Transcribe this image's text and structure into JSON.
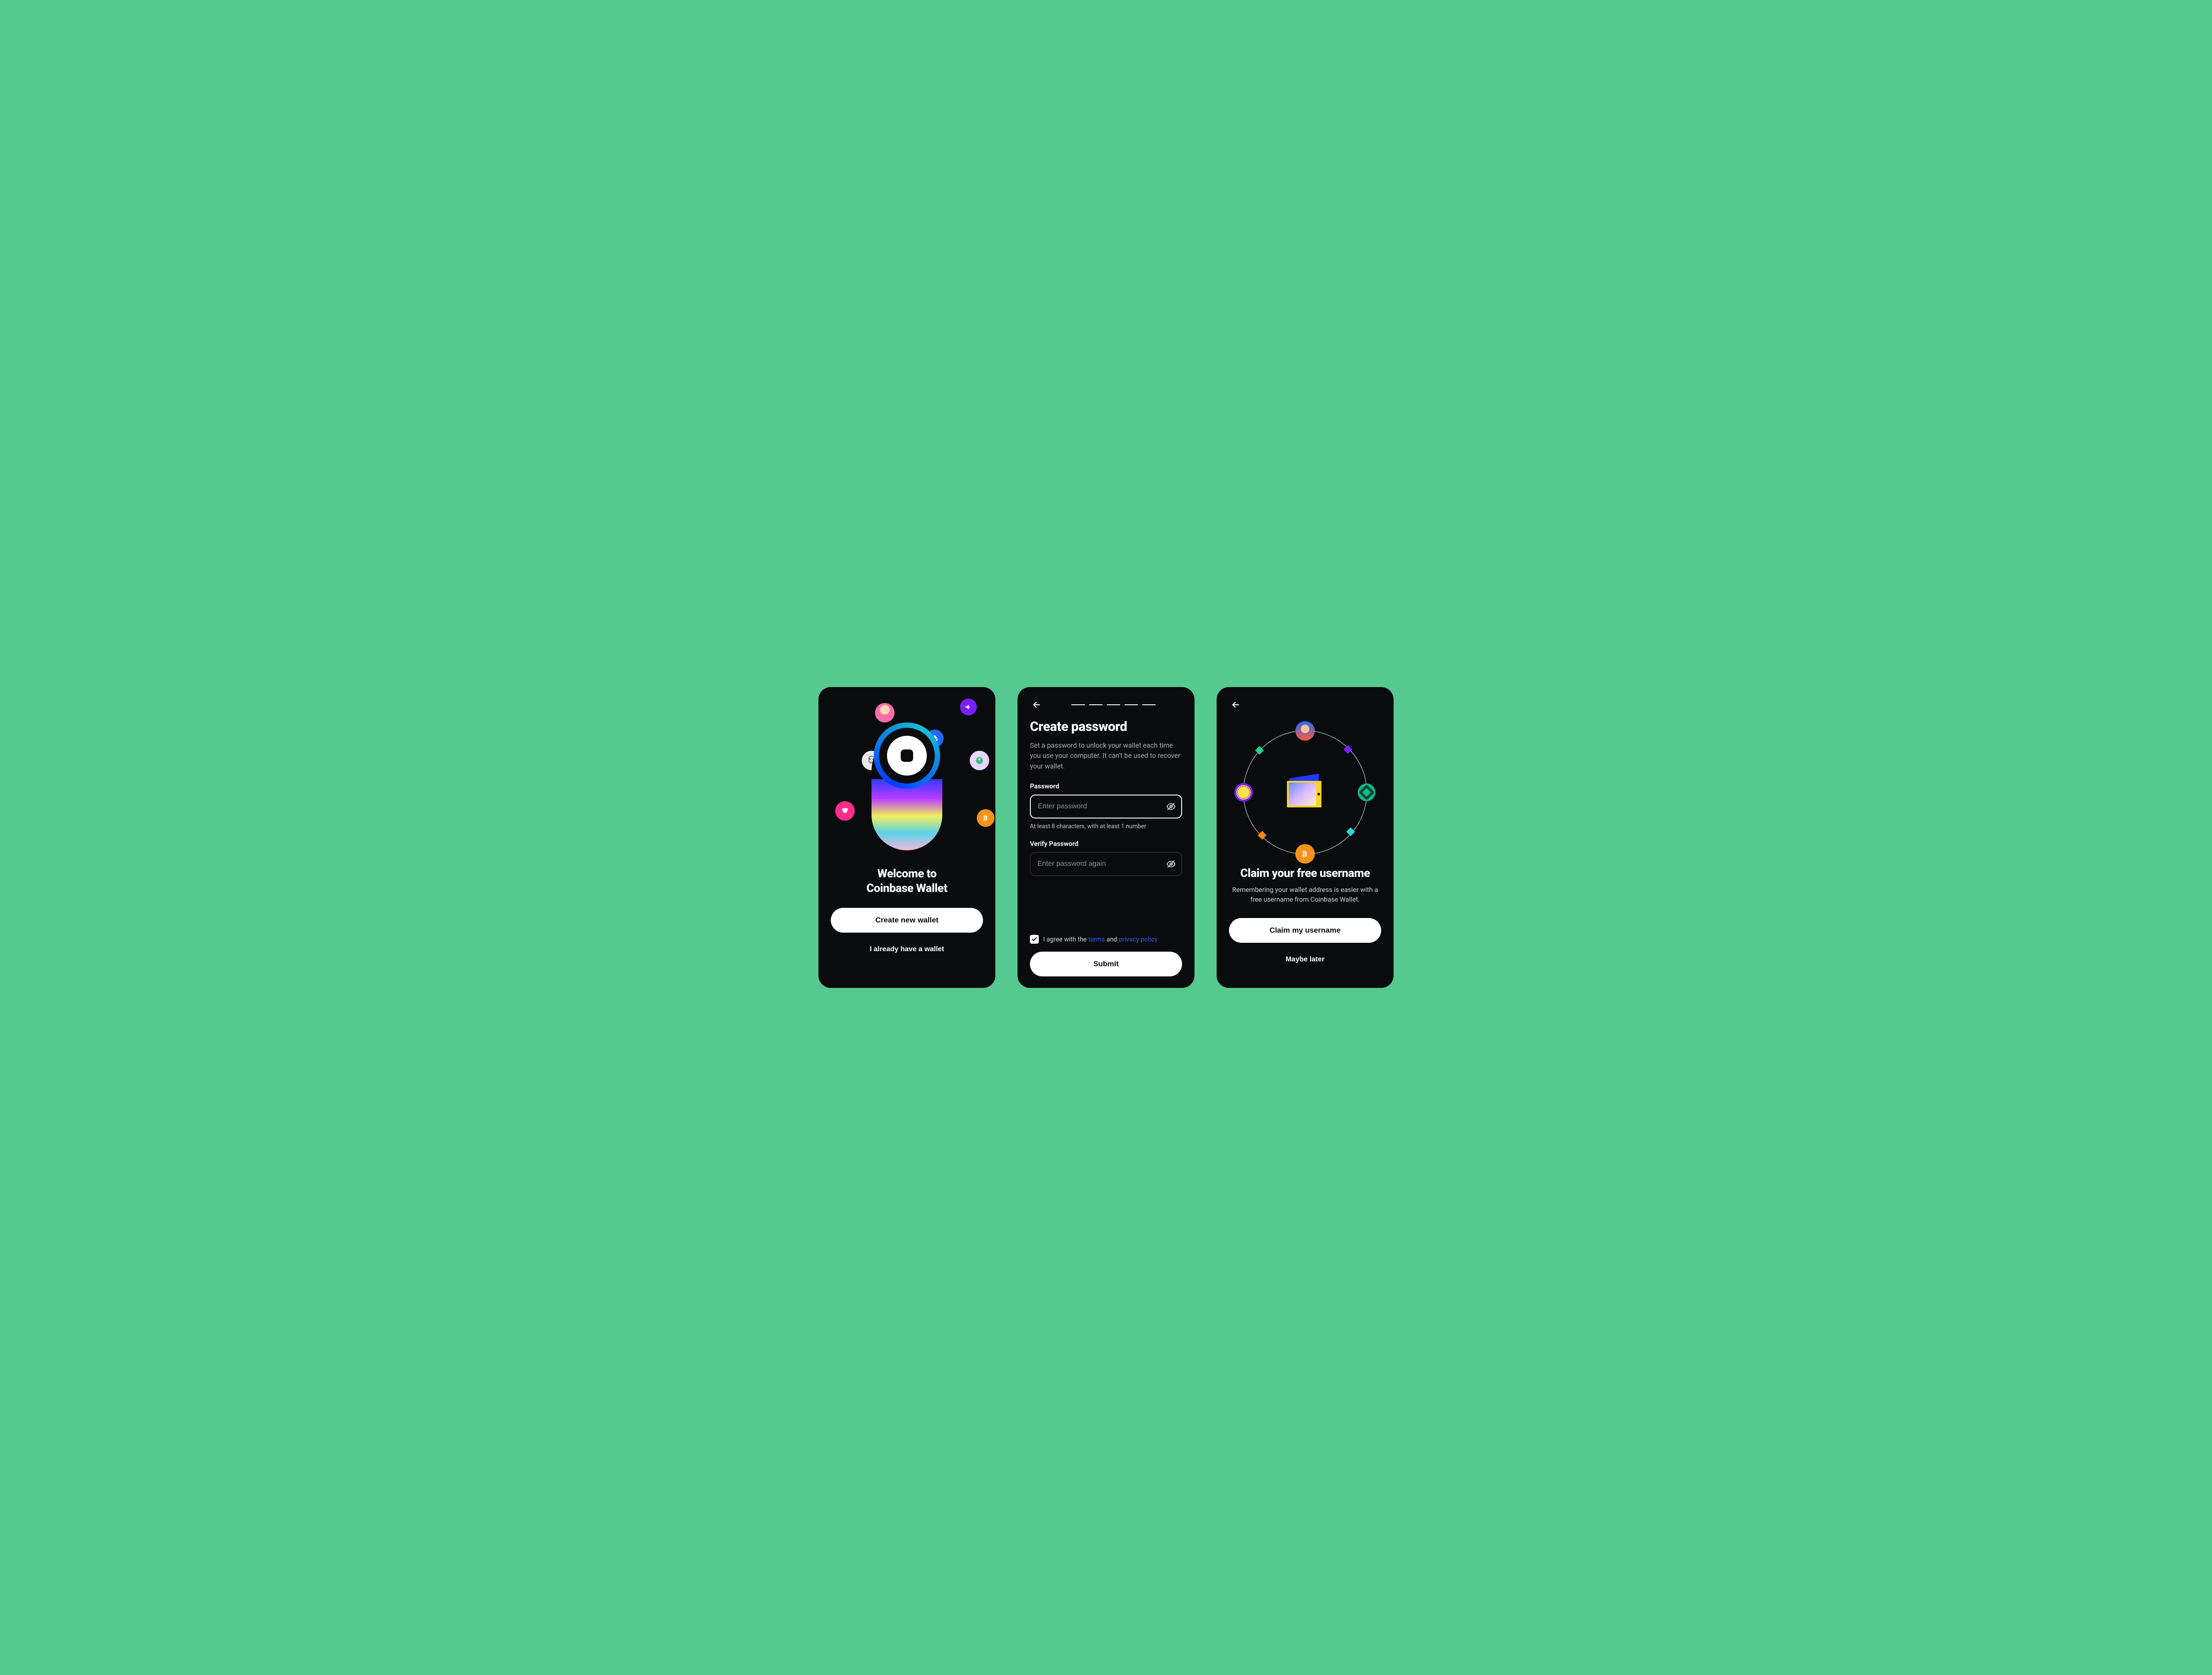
{
  "colors": {
    "bg": "#55c98f",
    "panel": "#0a0b0d",
    "link": "#2a5bff",
    "bitcoin": "#f7931a",
    "pink": "#ff2e8e",
    "blue": "#1f6bff",
    "purple": "#7a1fff",
    "green": "#14b88a"
  },
  "welcome": {
    "title_line1": "Welcome to",
    "title_line2": "Coinbase Wallet",
    "create_label": "Create new wallet",
    "have_label": "I already have a wallet"
  },
  "password": {
    "progress_total": 5,
    "progress_current": 1,
    "title": "Create password",
    "subtitle": "Set a password to unlock your wallet each time you use your computer. It can't be used to recover your wallet.",
    "password_label": "Password",
    "password_placeholder": "Enter password",
    "password_hint": "At least 8 characters, with at least 1 number",
    "verify_label": "Verify Password",
    "verify_placeholder": "Enter password again",
    "agree_prefix": "I agree with the ",
    "agree_terms": "terms",
    "agree_mid": " and ",
    "agree_privacy": "privacy policy",
    "agree_checked": true,
    "submit_label": "Submit"
  },
  "claim": {
    "title": "Claim your free username",
    "subtitle": "Remembering your wallet address is easier with a free username from Coinbase Wallet.",
    "claim_label": "Claim my username",
    "later_label": "Maybe later"
  }
}
